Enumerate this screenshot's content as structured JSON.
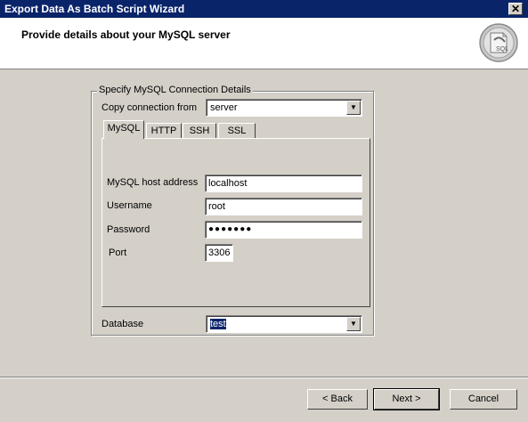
{
  "window": {
    "title": "Export Data As Batch Script Wizard",
    "close_glyph": "✕"
  },
  "header": {
    "title": "Provide details about your MySQL server",
    "logo_icon": "sql-database-icon",
    "logo_text": "SQL"
  },
  "group": {
    "label": "Specify MySQL Connection Details",
    "copy_from_label": "Copy connection from",
    "copy_from_value": "server"
  },
  "tabs": [
    {
      "label": "MySQL",
      "active": true
    },
    {
      "label": "HTTP",
      "active": false
    },
    {
      "label": "SSH",
      "active": false
    },
    {
      "label": "SSL",
      "active": false
    }
  ],
  "mysql": {
    "host_label": "MySQL host address",
    "host_value": "localhost",
    "user_label": "Username",
    "user_value": "root",
    "password_label": "Password",
    "password_value": "●●●●●●●",
    "port_label": "Port",
    "port_value": "3306"
  },
  "database": {
    "label": "Database",
    "value": "test"
  },
  "buttons": {
    "back": "< Back",
    "next": "Next >",
    "cancel": "Cancel"
  }
}
